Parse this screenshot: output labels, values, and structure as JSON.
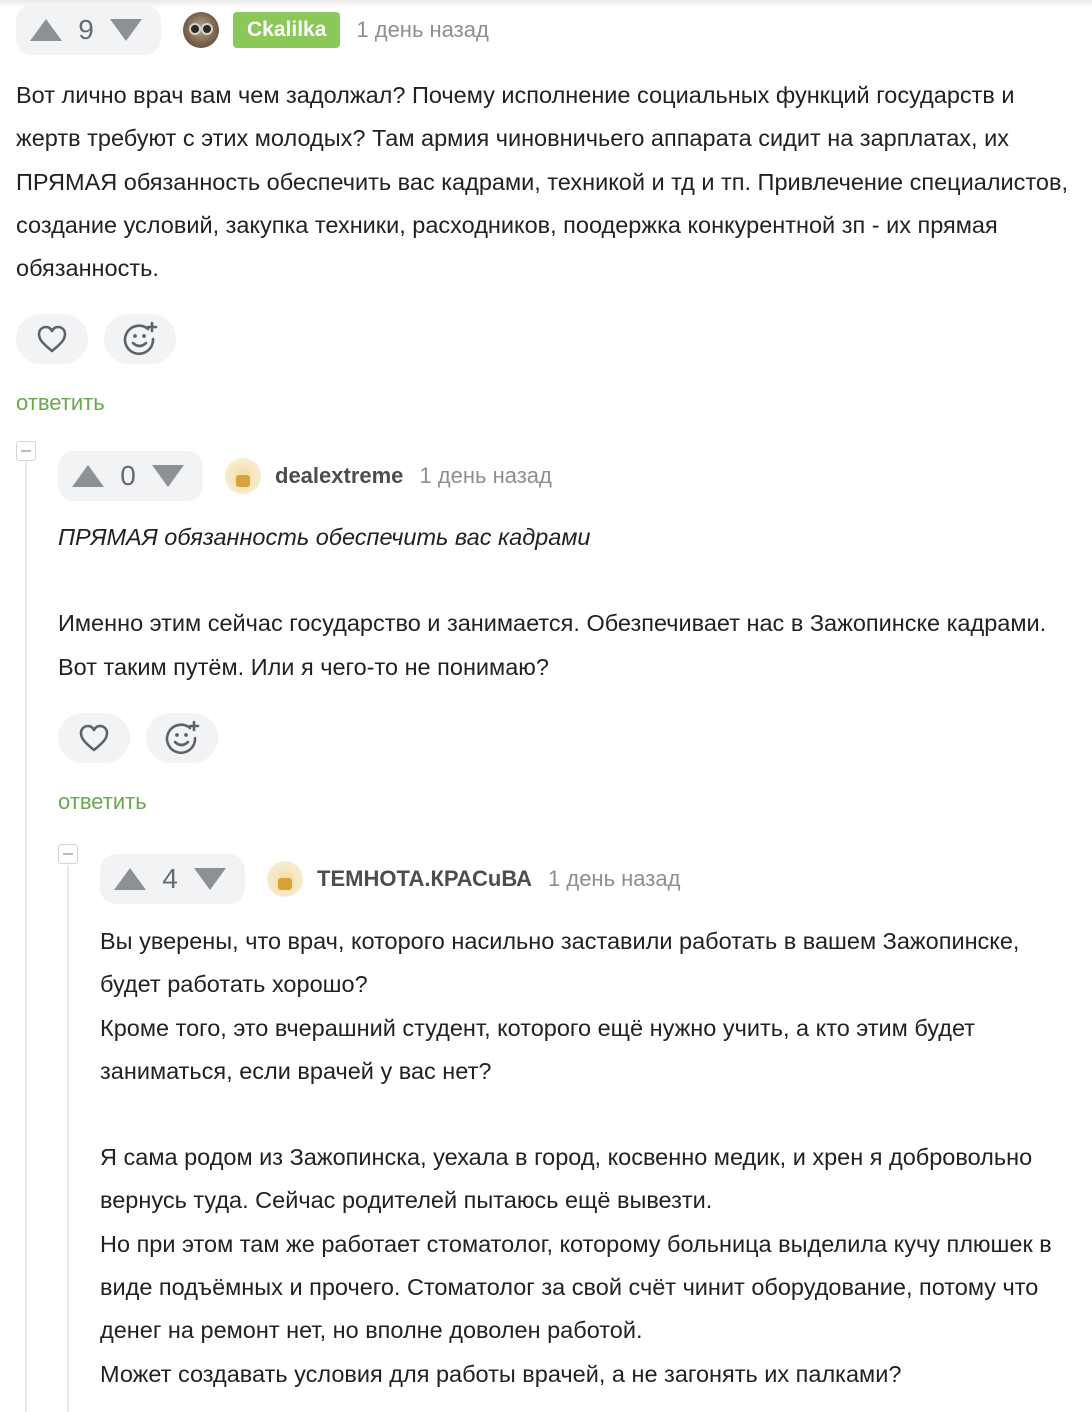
{
  "comments": [
    {
      "score": "9",
      "author": "Ckalilka",
      "time": "1 день назад",
      "paragraphs": [
        "Вот лично врач вам чем задолжал? Почему исполнение социальных функций государств и жертв требуют с этих молодых? Там армия чиновничьего аппарата сидит на зарплатах, их ПРЯМАЯ обязанность обеспечить вас кадрами, техникой и тд и тп. Привлечение специалистов, создание условий, закупка техники, расходников, поодержка конкурентной зп - их прямая обязанность."
      ],
      "reply_label": "ответить"
    },
    {
      "score": "0",
      "author": "dealextreme",
      "time": "1 день назад",
      "quote": "ПРЯМАЯ обязанность обеспечить вас кадрами",
      "paragraphs": [
        "Именно этим сейчас государство и занимается. Обезпечивает нас в Зажопинске кадрами. Вот таким путём. Или я чего-то не понимаю?"
      ],
      "reply_label": "ответить"
    },
    {
      "score": "4",
      "author": "ТЕМНОТА.КРАСuВА",
      "time": "1 день назад",
      "paragraphs": [
        "Вы уверены, что врач, которого насильно заставили работать в вашем Зажопинске, будет работать хорошо?\nКроме того, это вчерашний студент, которого ещё нужно учить, а кто этим будет заниматься, если врачей у вас нет?",
        "Я сама родом из Зажопинска, уехала в город, косвенно медик, и хрен я добровольно вернусь туда. Сейчас родителей пытаюсь ещё вывезти.\nНо при этом там же работает стоматолог, которому больница выделила кучу плюшек в виде подъёмных и прочего. Стоматолог за свой счёт чинит оборудование, потому что денег на ремонт нет, но вполне доволен работой.\nМожет создавать условия для работы врачей, а не загонять их палками?"
      ]
    }
  ],
  "colors": {
    "accent_green": "#6aa84f",
    "badge_green": "#8ac858",
    "vote_bg": "#f2f3f5"
  },
  "icons": [
    "arrow-up-icon",
    "arrow-down-icon",
    "heart-icon",
    "add-emoji-icon",
    "collapse-icon"
  ]
}
